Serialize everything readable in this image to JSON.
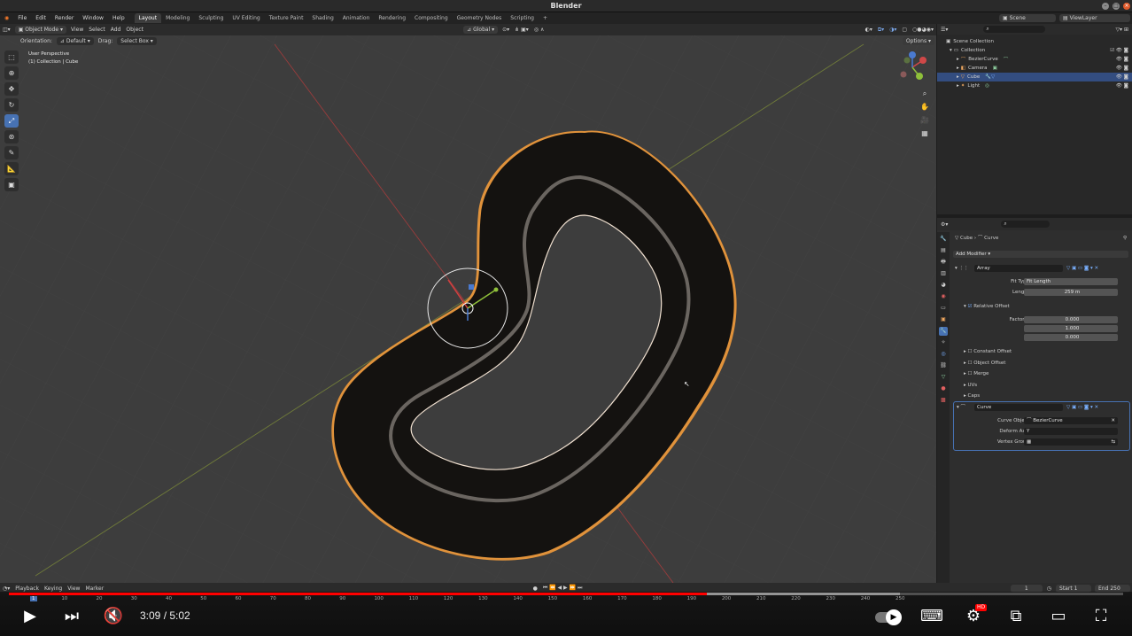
{
  "window": {
    "title": "Blender"
  },
  "menu": {
    "items": [
      "File",
      "Edit",
      "Render",
      "Window",
      "Help"
    ],
    "workspaces": [
      "Layout",
      "Modeling",
      "Sculpting",
      "UV Editing",
      "Texture Paint",
      "Shading",
      "Animation",
      "Rendering",
      "Compositing",
      "Geometry Nodes",
      "Scripting"
    ],
    "active_workspace": "Layout",
    "add_tab": "+",
    "scene": "Scene",
    "view_layer": "ViewLayer"
  },
  "viewport_header": {
    "mode": "Object Mode",
    "menus": [
      "View",
      "Select",
      "Add",
      "Object"
    ],
    "transform_orientation": "Global",
    "orientation_label": "Orientation:",
    "orientation_value": "Default",
    "drag_label": "Drag:",
    "drag_value": "Select Box",
    "options": "Options"
  },
  "viewport": {
    "perspective": "User Perspective",
    "collection_info": "(1) Collection | Cube"
  },
  "outliner": {
    "root": "Scene Collection",
    "collection": "Collection",
    "items": [
      {
        "name": "BezierCurve",
        "selected": false
      },
      {
        "name": "Camera",
        "selected": false
      },
      {
        "name": "Cube",
        "selected": true
      },
      {
        "name": "Light",
        "selected": false
      }
    ]
  },
  "properties": {
    "breadcrumb_object": "Cube",
    "breadcrumb_modifier": "Curve",
    "add_modifier": "Add Modifier",
    "array": {
      "name": "Array",
      "fit_type_label": "Fit Type",
      "fit_type": "Fit Length",
      "length_label": "Length",
      "length": "259 m",
      "relative_offset": "Relative Offset",
      "factor_x_label": "Factor X",
      "factor_x": "0.000",
      "y_label": "Y",
      "y": "1.000",
      "z_label": "Z",
      "z": "0.000",
      "constant_offset": "Constant Offset",
      "object_offset": "Object Offset",
      "merge": "Merge",
      "uvs": "UVs",
      "caps": "Caps"
    },
    "curve": {
      "name": "Curve",
      "curve_object_label": "Curve Object",
      "curve_object": "BezierCurve",
      "deform_axis_label": "Deform Axis",
      "deform_axis": "Y",
      "vertex_group_label": "Vertex Group"
    }
  },
  "timeline": {
    "menus": [
      "Playback",
      "Keying",
      "View",
      "Marker"
    ],
    "current_frame": "1",
    "start_label": "Start",
    "start": "1",
    "end_label": "End",
    "end": "250",
    "ruler": [
      "1",
      "10",
      "20",
      "30",
      "40",
      "50",
      "60",
      "70",
      "80",
      "90",
      "100",
      "110",
      "120",
      "130",
      "140",
      "150",
      "160",
      "170",
      "180",
      "190",
      "200",
      "210",
      "220",
      "230",
      "240",
      "250"
    ]
  },
  "player": {
    "current_time": "3:09",
    "duration": "5:02",
    "progress": 0.626,
    "loaded": 0.8,
    "hd_badge": "HD",
    "colors": {
      "played": "#ff0000",
      "accent": "#4772b3",
      "selection_outline": "#f29b3b"
    }
  }
}
